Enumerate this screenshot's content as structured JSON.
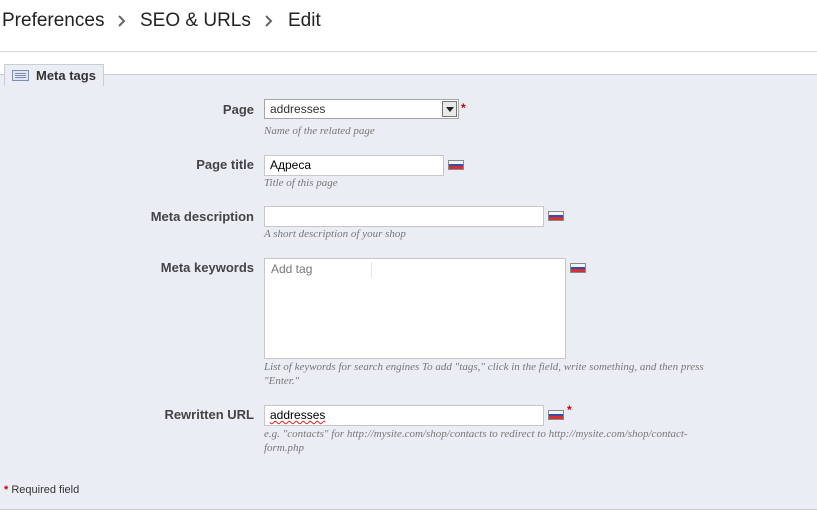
{
  "breadcrumb": {
    "items": [
      "Preferences",
      "SEO & URLs",
      "Edit"
    ]
  },
  "panel": {
    "legend": "Meta tags",
    "legend_icon": "keyboard-icon"
  },
  "fields": {
    "page": {
      "label": "Page",
      "value": "addresses",
      "hint": "Name of the related page",
      "required": "*"
    },
    "page_title": {
      "label": "Page title",
      "value": "Адреса",
      "hint": "Title of this page"
    },
    "meta_description": {
      "label": "Meta description",
      "value": "",
      "hint": "A short description of your shop"
    },
    "meta_keywords": {
      "label": "Meta keywords",
      "placeholder": "Add tag",
      "hint_line1": "List of keywords for search engines To add \"tags,\" click in the field, write something, and then press",
      "hint_line2": "\"Enter.\""
    },
    "rewritten_url": {
      "label": "Rewritten URL",
      "value": "addresses",
      "hint_line1": "e.g. \"contacts\" for http://mysite.com/shop/contacts to redirect to http://mysite.com/shop/contact-",
      "hint_line2": "form.php",
      "required": "*"
    }
  },
  "footer": {
    "required_star": "*",
    "required_text": "Required field"
  },
  "colors": {
    "panel_bg": "#ebedf4",
    "required": "#cc0000",
    "flag_white": "#f4f4f4",
    "flag_blue": "#2f4fb0",
    "flag_red": "#d63030"
  }
}
